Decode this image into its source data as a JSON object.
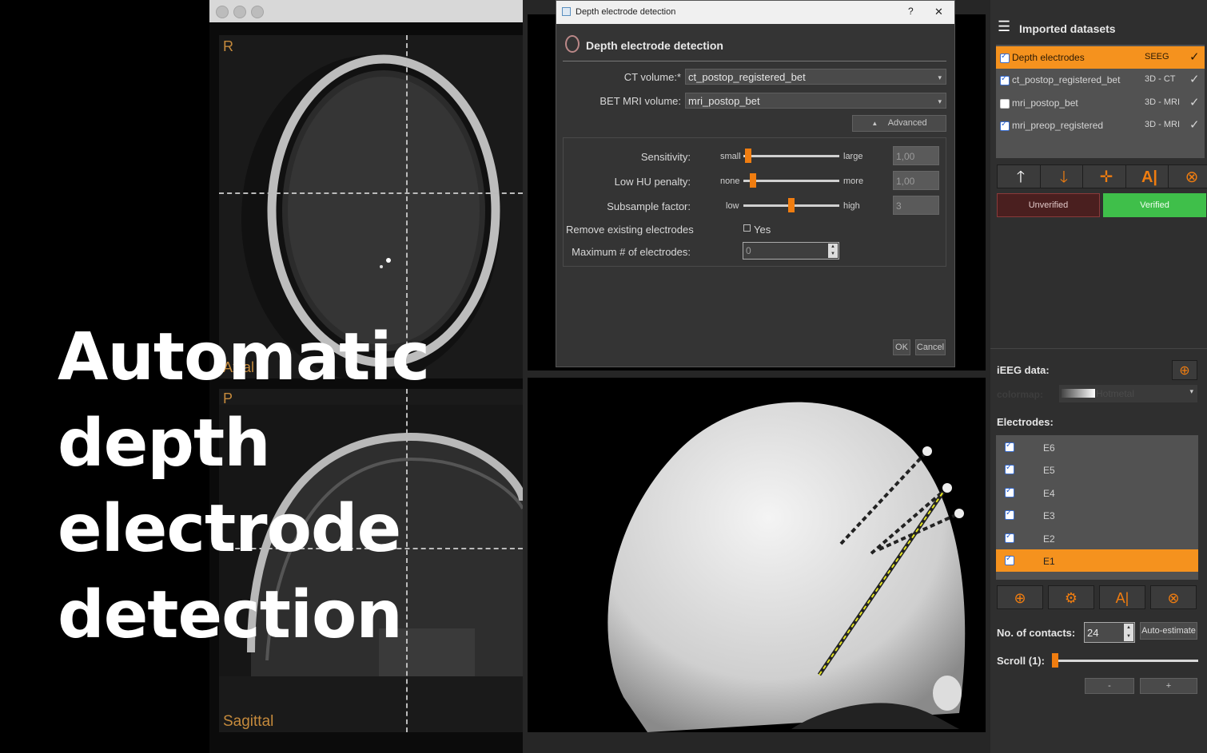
{
  "overlay_title": {
    "lines": [
      "Automatic",
      "depth",
      "electrode",
      "detection"
    ]
  },
  "slice_viewer": {
    "axial": {
      "orientation_label": "R",
      "view_label": "Axial"
    },
    "sagittal": {
      "orientation_label": "P",
      "view_label": "Sagittal"
    }
  },
  "dialog": {
    "window_title": "Depth electrode detection",
    "help_label": "?",
    "close_label": "✕",
    "header": "Depth electrode detection",
    "ct_label": "CT volume:*",
    "ct_value": "ct_postop_registered_bet",
    "bet_label": "BET MRI volume:",
    "bet_value": "mri_postop_bet",
    "advanced_label": "Advanced",
    "sensitivity": {
      "label": "Sensitivity:",
      "min": "small",
      "max": "large",
      "value": "1,00",
      "level": 0.05
    },
    "low_hu": {
      "label": "Low HU penalty:",
      "min": "none",
      "max": "more",
      "value": "1,00",
      "level": 0.1
    },
    "subsample": {
      "label": "Subsample factor:",
      "min": "low",
      "max": "high",
      "value": "3",
      "level": 0.5
    },
    "remove_label": "Remove existing electrodes",
    "remove_option": "Yes",
    "max_label": "Maximum # of electrodes:",
    "max_value": "0",
    "ok_label": "OK",
    "cancel_label": "Cancel"
  },
  "right_panel": {
    "datasets_title": "Imported datasets",
    "datasets": [
      {
        "name": "Depth electrodes",
        "type": "SEEG",
        "checked": true,
        "selected": true
      },
      {
        "name": "ct_postop_registered_bet",
        "type": "3D - CT",
        "checked": true,
        "selected": false
      },
      {
        "name": "mri_postop_bet",
        "type": "3D - MRI",
        "checked": false,
        "selected": false
      },
      {
        "name": "mri_preop_registered",
        "type": "3D - MRI",
        "checked": true,
        "selected": false
      }
    ],
    "verified_mark": "✓",
    "unverified_label": "Unverified",
    "verified_label": "Verified",
    "ieeg_label": "iEEG data:",
    "colormap_label": "colormap:",
    "colormap_value": "Hotmetal",
    "electrodes_label": "Electrodes:",
    "electrodes": [
      "E6",
      "E5",
      "E4",
      "E3",
      "E2",
      "E1"
    ],
    "contacts_label": "No. of contacts:",
    "contacts_value": "24",
    "auto_estimate_label": "Auto-estimate",
    "scroll_label": "Scroll (1):",
    "minus_label": "-",
    "plus_label": "+"
  },
  "colors": {
    "accent": "#f07d10",
    "selected_row": "#f5921e",
    "verified": "#3fbf4a",
    "unverified": "#7a2a2a"
  }
}
